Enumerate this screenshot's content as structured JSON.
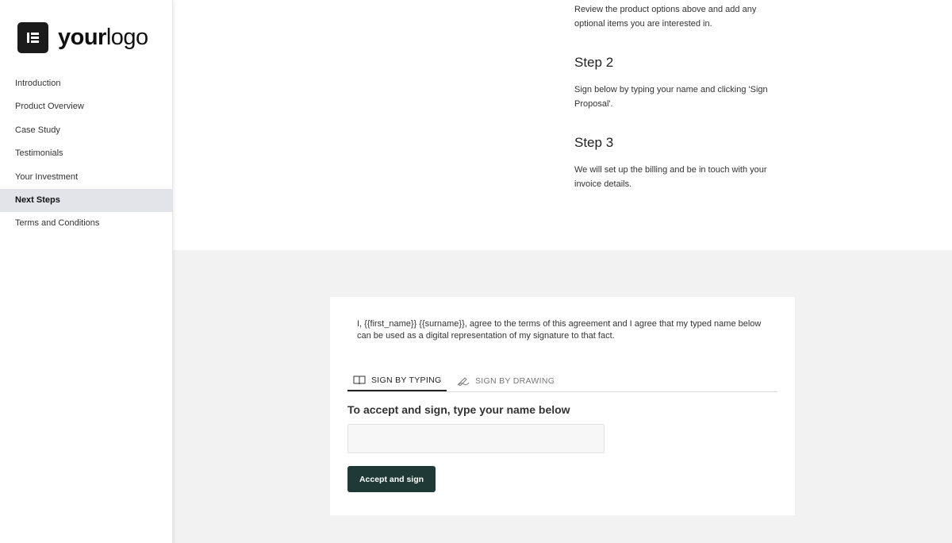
{
  "logo": {
    "text_part1": "your",
    "text_part2": "logo"
  },
  "sidebar": {
    "items": [
      {
        "label": "Introduction",
        "active": false
      },
      {
        "label": "Product Overview",
        "active": false
      },
      {
        "label": "Case Study",
        "active": false
      },
      {
        "label": "Testimonials",
        "active": false
      },
      {
        "label": "Your Investment",
        "active": false
      },
      {
        "label": "Next Steps",
        "active": true
      },
      {
        "label": "Terms and Conditions",
        "active": false
      }
    ]
  },
  "steps": {
    "intro_text": "Review the product options above and add any optional items you are interested in.",
    "step2_title": "Step 2",
    "step2_text": "Sign below by typing your name and clicking 'Sign Proposal'.",
    "step3_title": "Step 3",
    "step3_text": "We will set up the billing and be in touch with your invoice details."
  },
  "signature": {
    "agreement_text": "I, {{first_name}} {{surname}}, agree to the terms of this agreement and I agree that my typed name below can be used as a digital representation of my signature to that fact.",
    "tab_typing": "SIGN BY TYPING",
    "tab_drawing": "SIGN BY DRAWING",
    "prompt": "To accept and sign, type your name below",
    "input_value": "",
    "input_placeholder": "",
    "button_label": "Accept and sign"
  },
  "colors": {
    "accent": "#1f3a36",
    "active_nav_bg": "#e2e4ea",
    "bottom_bg": "#f2f2f2"
  }
}
